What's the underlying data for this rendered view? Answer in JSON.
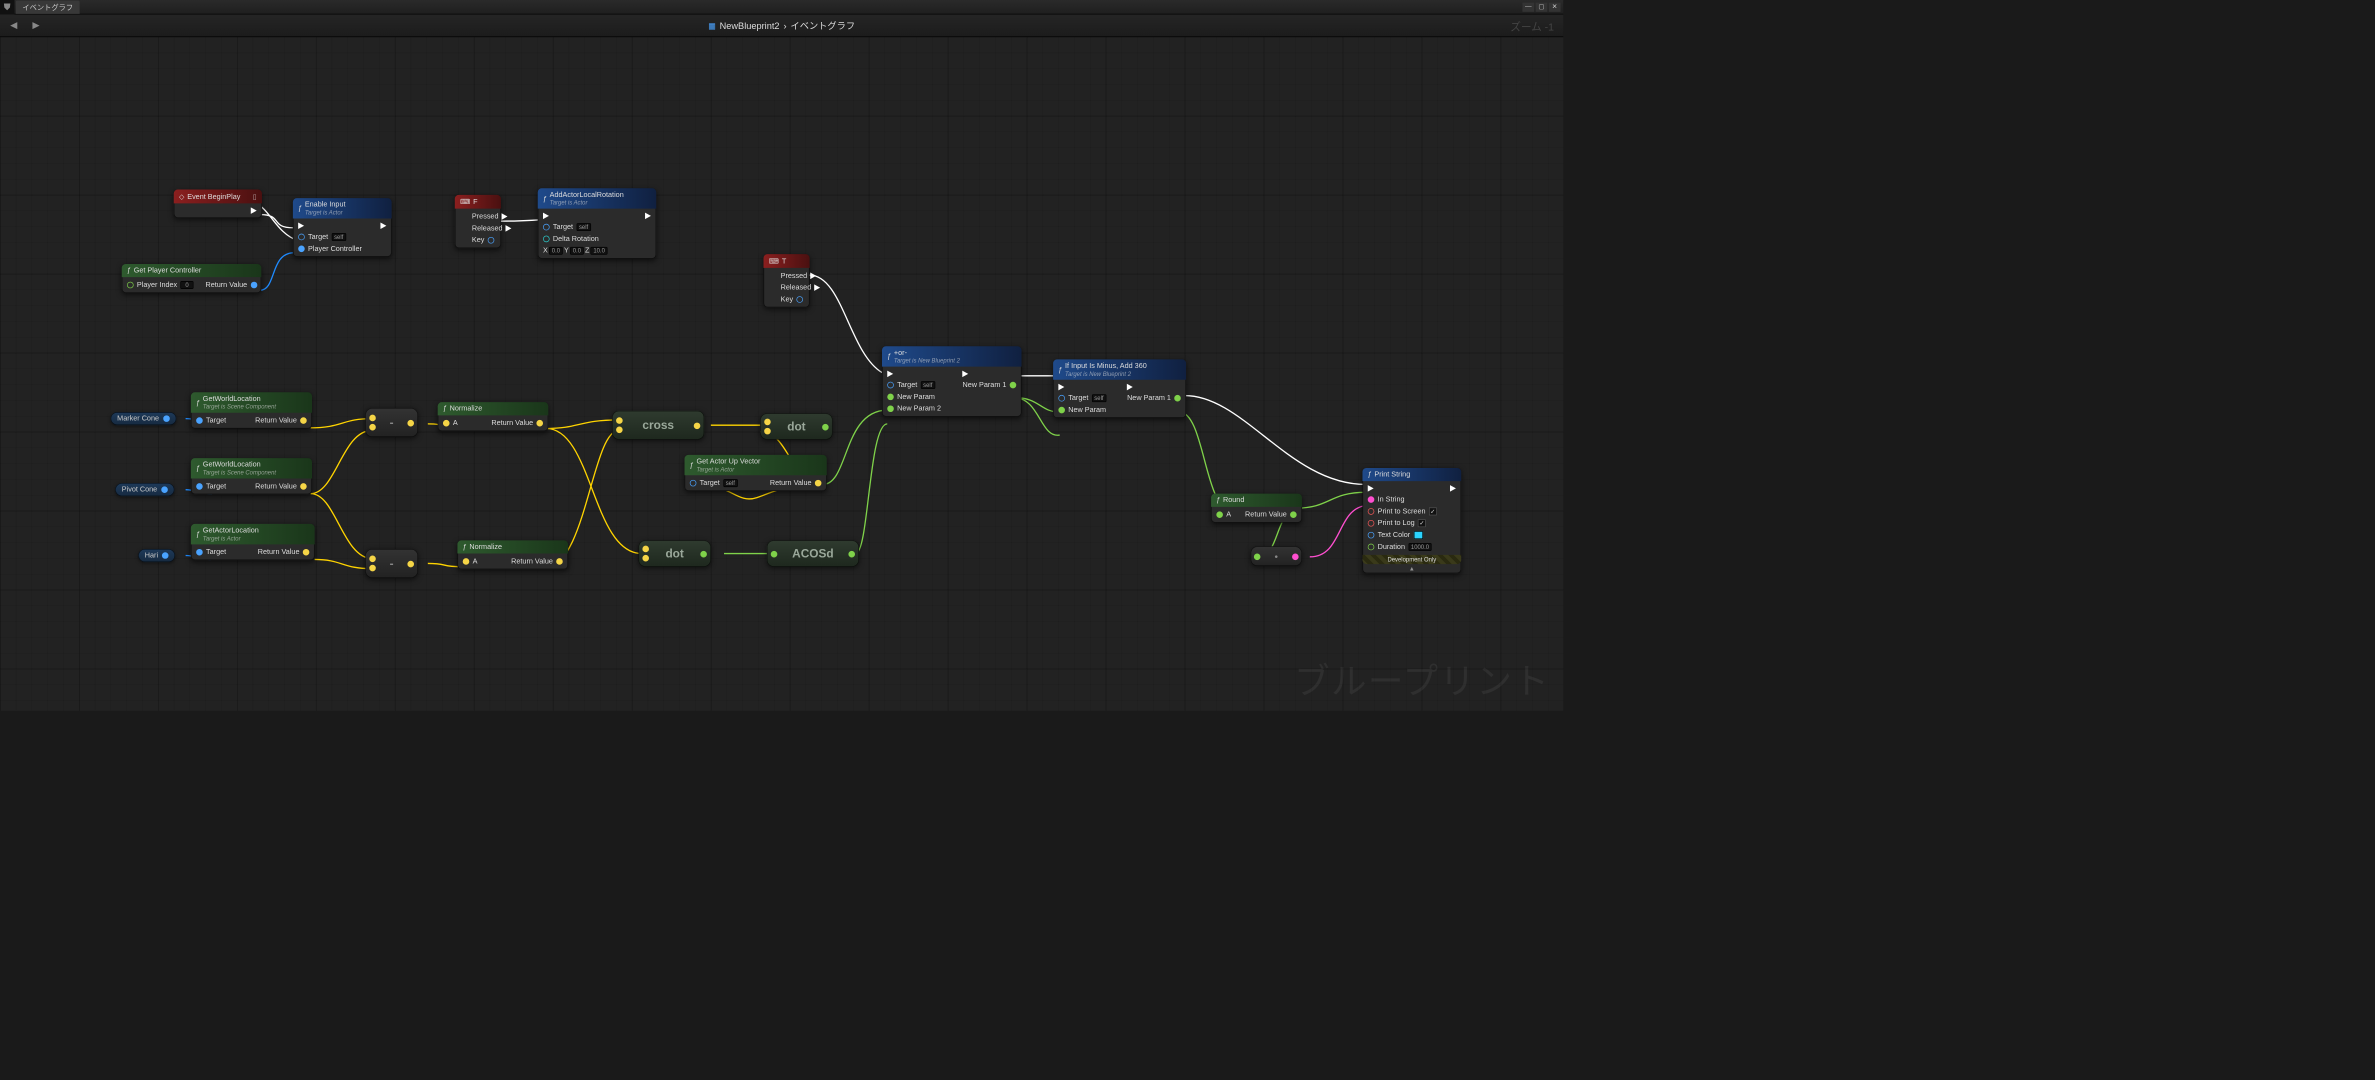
{
  "tab_title": "イベントグラフ",
  "breadcrumb": {
    "root": "NewBlueprint2",
    "leaf": "イベントグラフ"
  },
  "zoom": "ズーム -1",
  "watermark": "ブループリント",
  "labels": {
    "pressed": "Pressed",
    "released": "Released",
    "key": "Key",
    "target": "Target",
    "self": "self",
    "return_value": "Return Value",
    "player_index": "Player Index",
    "player_controller": "Player Controller",
    "delta_rotation": "Delta Rotation",
    "new_param": "New Param",
    "new_param1": "New Param 1",
    "new_param2": "New Param 2",
    "a": "A",
    "in_string": "In String",
    "print_screen": "Print to Screen",
    "print_log": "Print to Log",
    "text_color": "Text Color",
    "duration": "Duration",
    "dev_only": "Development Only"
  },
  "nodes": {
    "begin": {
      "title": "Event BeginPlay"
    },
    "enableInput": {
      "title": "Enable Input",
      "sub": "Target is Actor"
    },
    "playerCtrl": {
      "title": "Get Player Controller",
      "idx": "0"
    },
    "keyF": {
      "title": "F"
    },
    "keyT": {
      "title": "T"
    },
    "addRot": {
      "title": "AddActorLocalRotation",
      "sub": "Target is Actor",
      "x": "0.0",
      "y": "0.0",
      "z": "10.0"
    },
    "marker": "Marker Cone",
    "pivot": "Pivot Cone",
    "hari": "Hari",
    "gwl1": {
      "title": "GetWorldLocation",
      "sub": "Target is Scene Component"
    },
    "gwl2": {
      "title": "GetWorldLocation",
      "sub": "Target is Scene Component"
    },
    "gal": {
      "title": "GetActorLocation",
      "sub": "Target is Actor"
    },
    "norm": "Normalize",
    "cross": "cross",
    "dot": "dot",
    "acosd": "ACOSd",
    "sub": "-",
    "round": "Round",
    "upvec": {
      "title": "Get Actor Up Vector",
      "sub": "Target is Actor"
    },
    "plusminus": {
      "title": "+or-",
      "sub": "Target is New Blueprint 2"
    },
    "ifminus": {
      "title": "If Input Is Minus, Add 360",
      "sub": "Target is New Blueprint 2"
    },
    "print": {
      "title": "Print String",
      "duration": "1000.0"
    },
    "append": "•"
  }
}
